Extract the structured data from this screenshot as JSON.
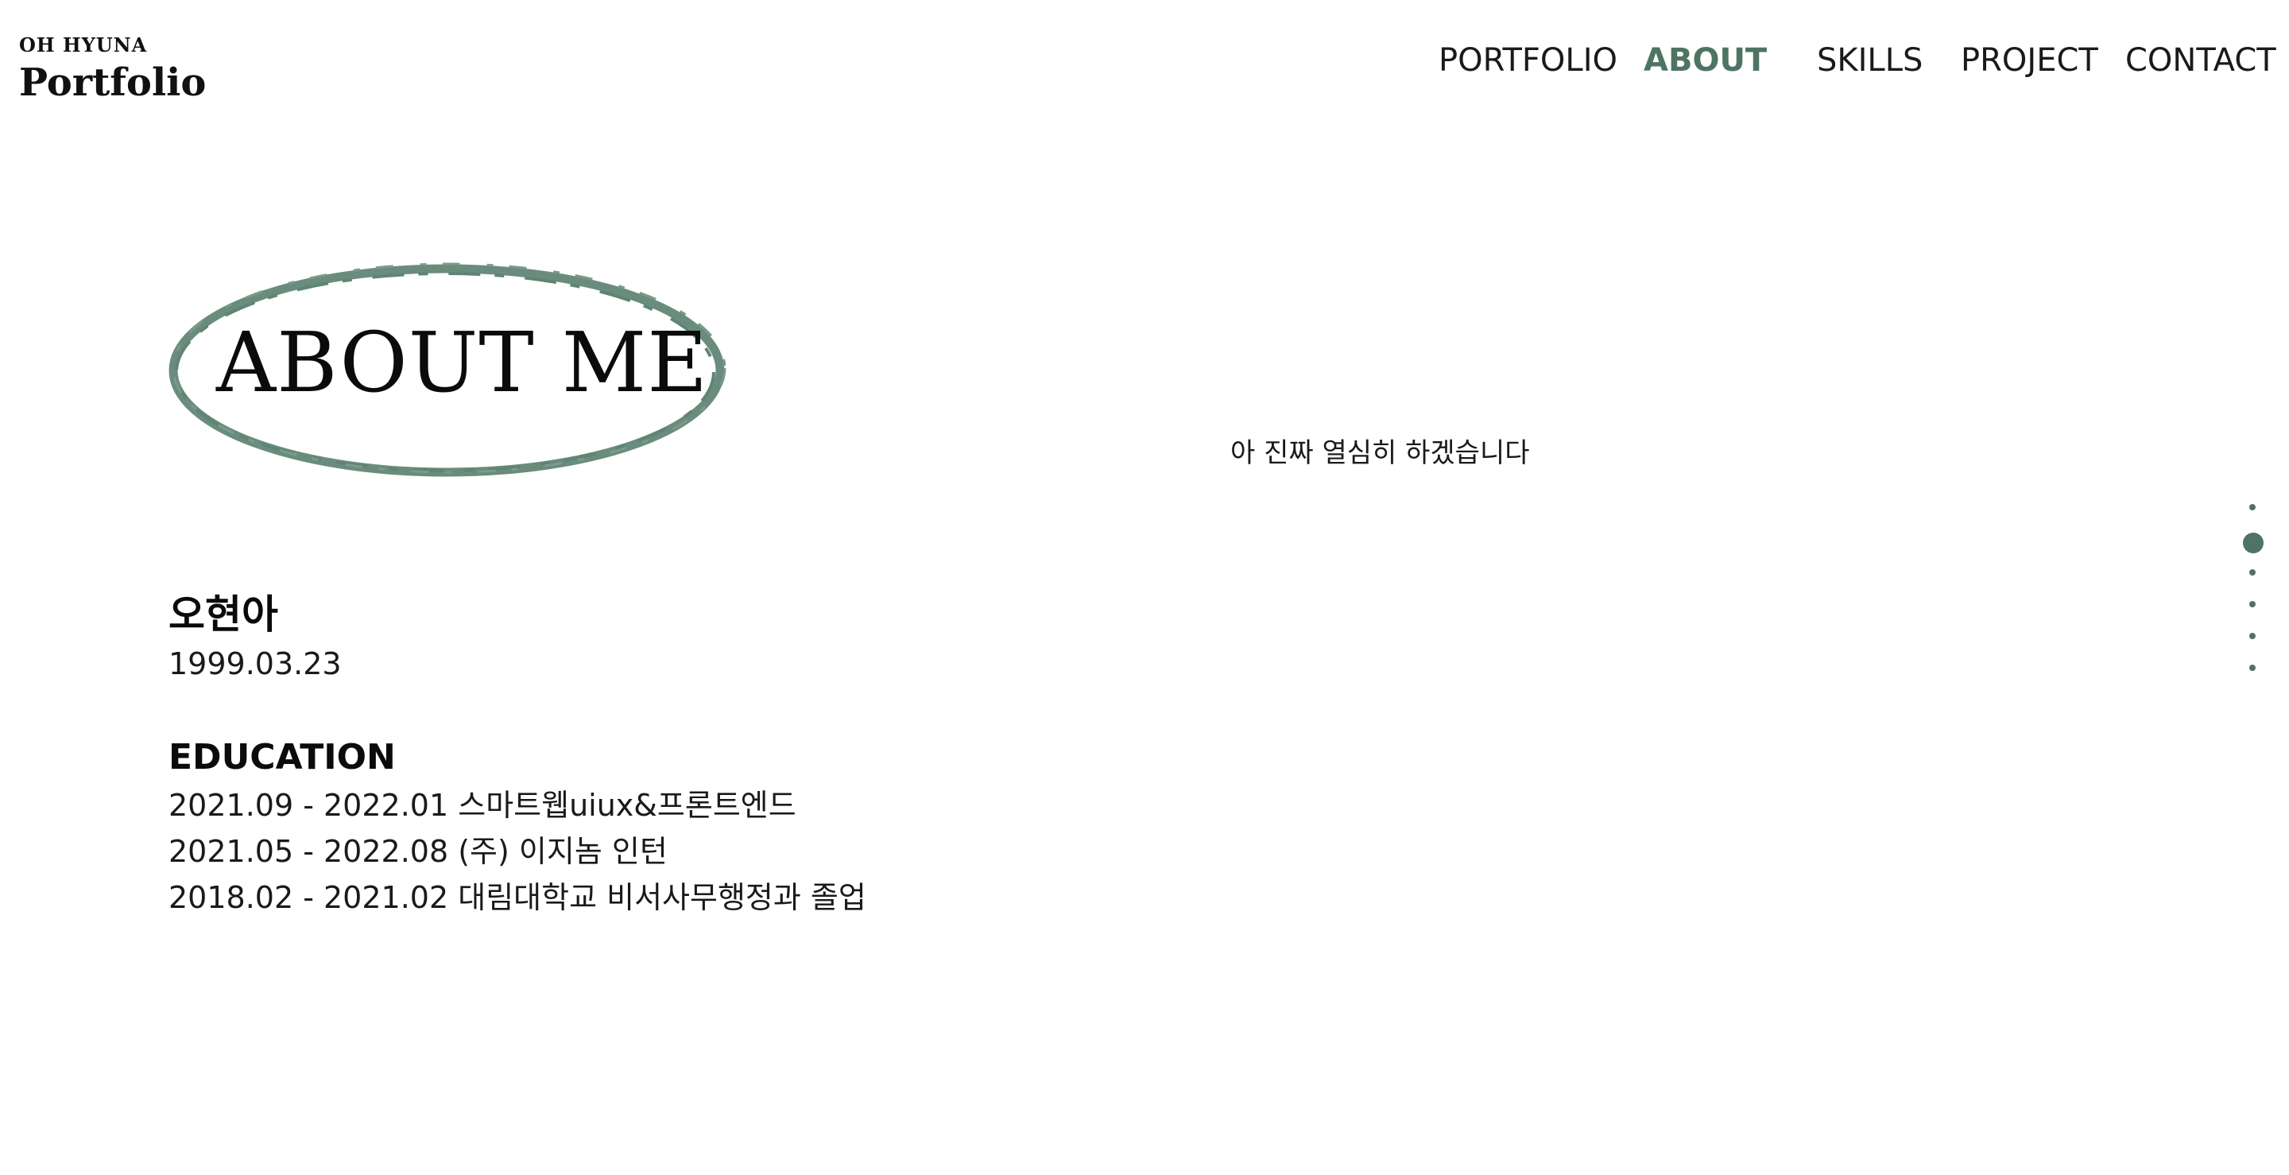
{
  "logo": {
    "small": "OH HYUNA",
    "big": "Portfolio"
  },
  "nav": {
    "items": [
      {
        "label": "PORTFOLIO",
        "active": false
      },
      {
        "label": "ABOUT",
        "active": true
      },
      {
        "label": "SKILLS",
        "active": false
      },
      {
        "label": "PROJECT",
        "active": false
      },
      {
        "label": "CONTACT",
        "active": false
      }
    ]
  },
  "about": {
    "title": "ABOUT ME",
    "tagline": "아 진짜 열심히 하겠습니다"
  },
  "profile": {
    "name": "오현아",
    "birth": "1999.03.23"
  },
  "education": {
    "title": "EDUCATION",
    "lines": [
      "2021.09 - 2022.01 스마트웹uiux&프론트엔드",
      "2021.05 - 2022.08 (주) 이지놈 인턴",
      "2018.02 - 2021.02 대림대학교 비서사무행정과 졸업"
    ]
  },
  "pager": {
    "count": 6,
    "active_index": 1
  },
  "colors": {
    "accent": "#4e7463",
    "text": "#111111",
    "background": "#ffffff"
  },
  "icons": {
    "title_frame": "brush-ellipse-icon",
    "pager_dot": "dot-icon"
  }
}
